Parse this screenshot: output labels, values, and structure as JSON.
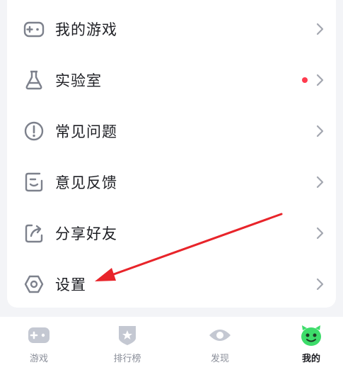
{
  "menu": {
    "items": [
      {
        "label": "我的游戏",
        "icon": "gamepad-icon"
      },
      {
        "label": "实验室",
        "icon": "flask-icon",
        "badge": "red-dot"
      },
      {
        "label": "常见问题",
        "icon": "info-circle-icon"
      },
      {
        "label": "意见反馈",
        "icon": "feedback-note-icon"
      },
      {
        "label": "分享好友",
        "icon": "share-icon"
      },
      {
        "label": "设置",
        "icon": "gear-icon"
      }
    ]
  },
  "tabbar": {
    "tabs": [
      {
        "label": "游戏",
        "icon": "gamepad-tab-icon",
        "active": false
      },
      {
        "label": "排行榜",
        "icon": "badge-star-icon",
        "active": false
      },
      {
        "label": "发现",
        "icon": "eye-icon",
        "active": false
      },
      {
        "label": "我的",
        "icon": "monster-avatar-icon",
        "active": true
      }
    ]
  },
  "colors": {
    "accent_green": "#3ddc6a",
    "dot_red": "#ff3b4e",
    "icon_gray": "#7d818c",
    "tab_icon_gray": "#c4c8d2",
    "annotation_red": "#e8242a"
  }
}
